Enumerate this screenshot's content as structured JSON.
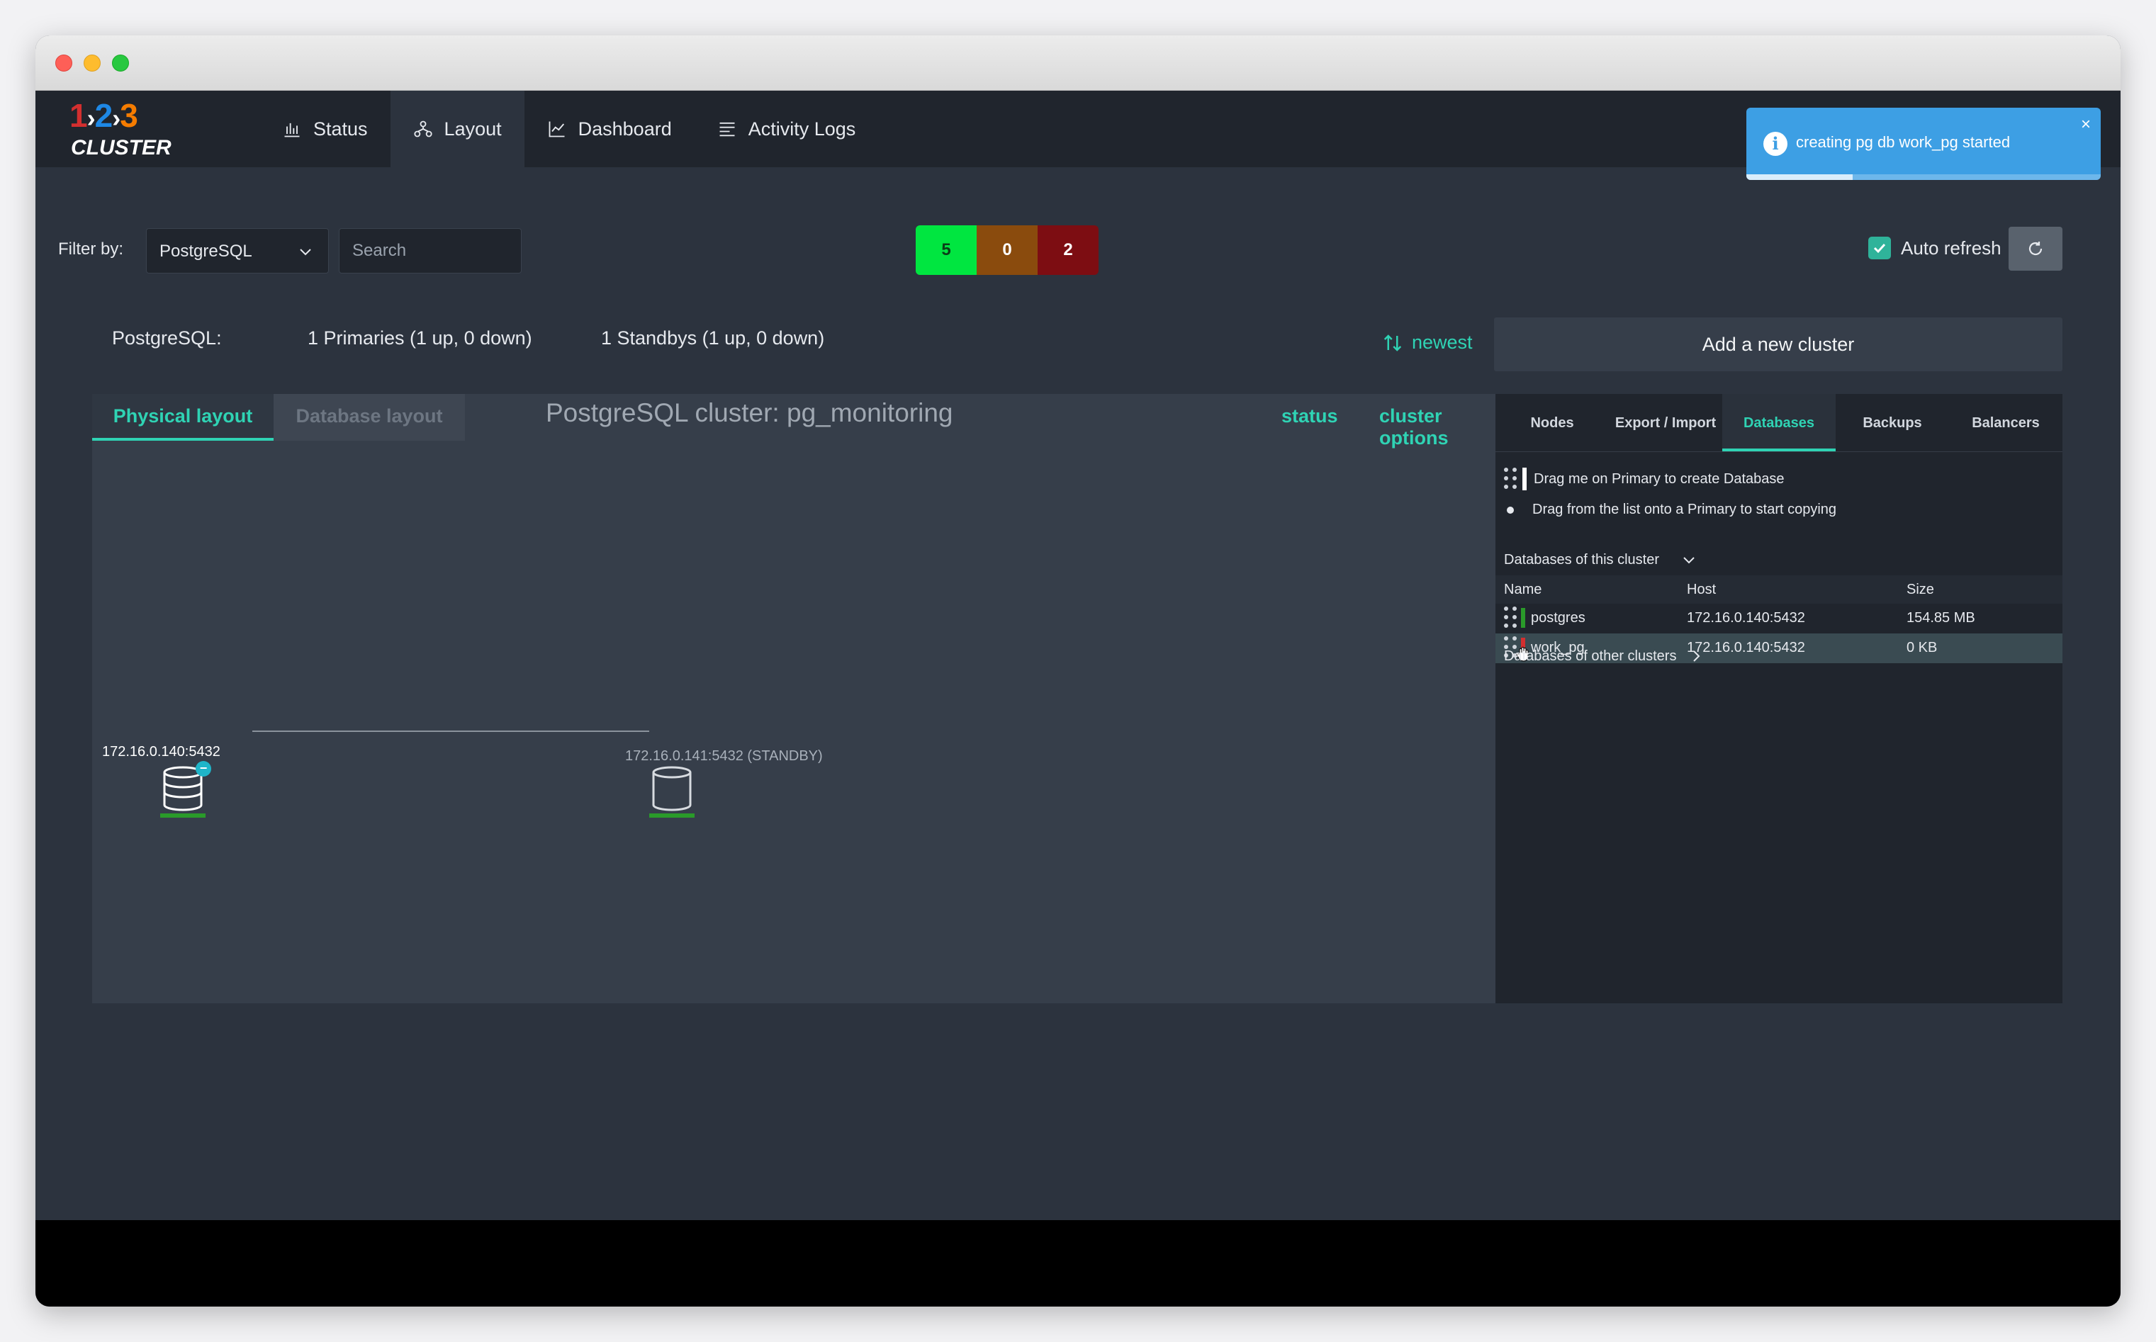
{
  "app": {
    "logo": {
      "n1": "1",
      "n2": "2",
      "n3": "3",
      "word": "CLUSTER"
    },
    "nav": [
      {
        "id": "status",
        "label": "Status",
        "icon": "bar-chart-icon"
      },
      {
        "id": "layout",
        "label": "Layout",
        "icon": "sitemap-icon",
        "active": true
      },
      {
        "id": "dashboard",
        "label": "Dashboard",
        "icon": "line-chart-icon"
      },
      {
        "id": "activity",
        "label": "Activity Logs",
        "icon": "list-icon"
      }
    ]
  },
  "toast": {
    "message": "creating pg db work_pg started",
    "close": "×",
    "progress": 0.3
  },
  "filter": {
    "label": "Filter by:",
    "selected": "PostgreSQL",
    "search_placeholder": "Search"
  },
  "counts": {
    "up": "5",
    "warn": "0",
    "down": "2"
  },
  "auto_refresh": {
    "label": "Auto refresh",
    "checked": true
  },
  "summary": {
    "type": "PostgreSQL:",
    "primaries": "1 Primaries (1 up, 0 down)",
    "standbys": "1 Standbys (1 up, 0 down)",
    "sort": "newest",
    "add_cluster": "Add a new cluster"
  },
  "layout_panel": {
    "tab_physical": "Physical layout",
    "tab_database": "Database layout",
    "title": "PostgreSQL cluster: pg_monitoring",
    "link_status": "status",
    "link_options": "cluster options",
    "primary": {
      "label": "172.16.0.140:5432"
    },
    "standby": {
      "label": "172.16.0.141:5432 (STANDBY)"
    }
  },
  "side_panel": {
    "tabs": [
      "Nodes",
      "Export / Import",
      "Databases",
      "Backups",
      "Balancers"
    ],
    "active_tab": "Databases",
    "drag_create": "Drag me on Primary to create Database",
    "drag_copy": "Drag from the list onto a Primary to start copying",
    "this_cluster": "Databases of this cluster",
    "other_clusters": "Databases of other clusters",
    "columns": {
      "name": "Name",
      "host": "Host",
      "size": "Size"
    },
    "databases": [
      {
        "name": "postgres",
        "host": "172.16.0.140:5432",
        "size": "154.85 MB",
        "status_color": "#2a9a2a"
      },
      {
        "name": "work_pg",
        "host": "172.16.0.140:5432",
        "size": "0 KB",
        "status_color": "#d32f2f"
      }
    ]
  }
}
